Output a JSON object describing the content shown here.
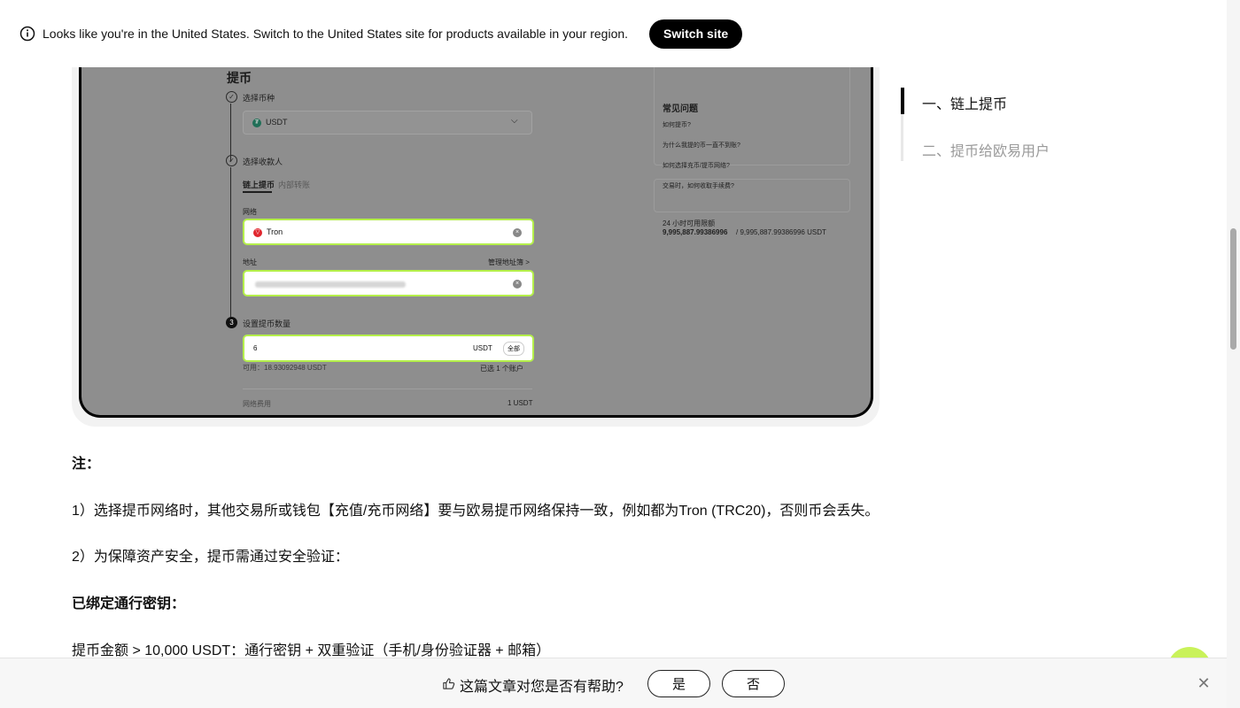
{
  "banner": {
    "text": "Looks like you're in the United States. Switch to the United States site for products available in your region.",
    "button_label": "Switch site",
    "icon": "info-icon"
  },
  "screenshot": {
    "title": "提币",
    "step1_label": "选择币种",
    "coin_value": "USDT",
    "step2_label": "选择收款人",
    "tab_onchain": "链上提币",
    "tab_internal": "内部转账",
    "network_label": "网络",
    "network_value": "Tron",
    "address_label": "地址",
    "address_book_link": "管理地址簿 >",
    "step3_number": "3",
    "step3_label": "设置提币数量",
    "amount_value": "6",
    "amount_unit": "USDT",
    "all_button": "全部",
    "available_text": "可用：18.93092948 USDT",
    "accounts_selected": "已选 1 个账户",
    "fee_label": "网络费用",
    "fee_value": "1 USDT",
    "faq_title": "常见问题",
    "faq_items": [
      "如何提币?",
      "为什么我提的币一直不到账?",
      "如何选择充币/提币网络?",
      "交易时，如何收取手续费?"
    ],
    "limit_label": "24 小时可用限额",
    "limit_value": "9,995,887.99386996",
    "limit_total": "/ 9,995,887.99386996 USDT"
  },
  "article": {
    "note_heading": "注：",
    "p1": "1）选择提币网络时，其他交易所或钱包【充值/充币网络】要与欧易提币网络保持一致，例如都为Tron (TRC20)，否则币会丢失。",
    "p2": "2）为保障资产安全，提币需通过安全验证：",
    "passkey_heading": "已绑定通行密钥：",
    "p3": "提币金额 > 10,000 USDT：通行密钥 + 双重验证（手机/身份验证器 + 邮箱）"
  },
  "toc": {
    "items": [
      {
        "label": "一、链上提币",
        "active": true
      },
      {
        "label": "二、提币给欧易用户",
        "active": false
      }
    ]
  },
  "feedback": {
    "question": "这篇文章对您是否有帮助?",
    "yes_label": "是",
    "no_label": "否",
    "icon": "thumbs-up-icon",
    "close_icon": "close-icon"
  },
  "colors": {
    "highlight": "#b4ef4a",
    "fab": "#c9f25a",
    "tron_red": "#e0262e",
    "usdt_green": "#26a17b"
  }
}
